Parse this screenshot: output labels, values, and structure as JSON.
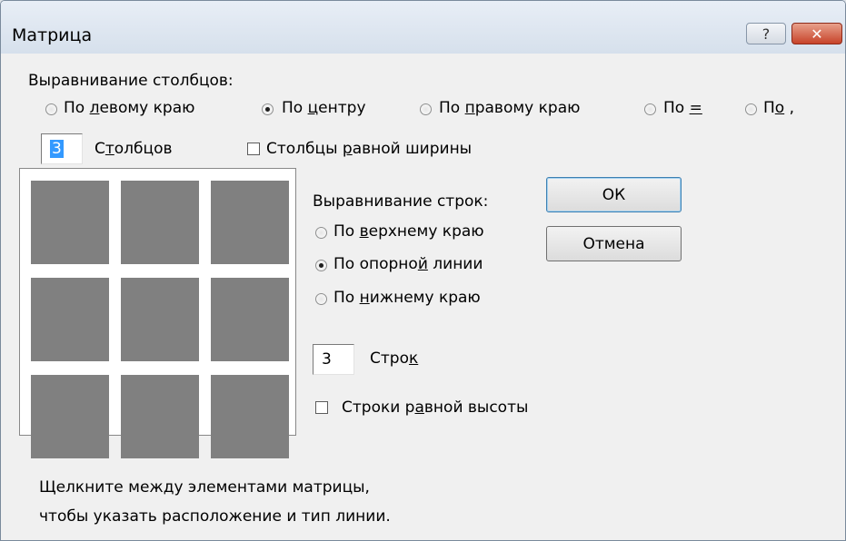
{
  "window": {
    "title": "Матрица",
    "help_label": "?",
    "close_label": "✕"
  },
  "columns": {
    "group_label": "Выравнивание столбцов:",
    "options": [
      {
        "pre": "По ",
        "key": "л",
        "post": "евому краю",
        "selected": false
      },
      {
        "pre": "По ",
        "key": "ц",
        "post": "ентру",
        "selected": true
      },
      {
        "pre": "По ",
        "key": "п",
        "post": "равому краю",
        "selected": false
      },
      {
        "pre": "По ",
        "key": "=",
        "post": "",
        "selected": false
      },
      {
        "pre": "П",
        "key": "о",
        "post": " ,",
        "selected": false
      }
    ],
    "count_value": "3",
    "count_label_pre": "С",
    "count_label_key": "т",
    "count_label_post": "олбцов",
    "equal_width_pre": "Столбцы ",
    "equal_width_key": "р",
    "equal_width_post": "авной ширины",
    "equal_width_checked": false
  },
  "rows": {
    "group_label": "Выравнивание строк:",
    "options": [
      {
        "pre": "По ",
        "key": "в",
        "post": "ерхнему краю",
        "selected": false
      },
      {
        "pre": "По опорно",
        "key": "й",
        "post": " линии",
        "selected": true
      },
      {
        "pre": "По ",
        "key": "н",
        "post": "ижнему краю",
        "selected": false
      }
    ],
    "count_value": "3",
    "count_label_pre": "Стро",
    "count_label_key": "к",
    "count_label_post": "",
    "equal_height_pre": "Строки р",
    "equal_height_key": "а",
    "equal_height_post": "вной высоты",
    "equal_height_checked": false
  },
  "buttons": {
    "ok": "ОК",
    "cancel": "Отмена"
  },
  "matrix": {
    "rows": 3,
    "cols": 3,
    "cell_color": "#808080"
  },
  "hint": {
    "line1": "Щелкните между элементами матрицы,",
    "line2": "чтобы указать расположение и тип линии."
  }
}
